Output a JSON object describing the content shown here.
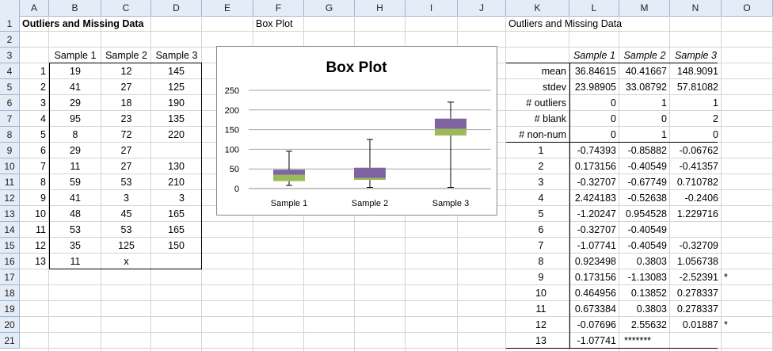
{
  "columns": [
    "A",
    "B",
    "C",
    "D",
    "E",
    "F",
    "G",
    "H",
    "I",
    "J",
    "K",
    "L",
    "M",
    "N",
    "O"
  ],
  "rows": [
    "1",
    "2",
    "3",
    "4",
    "5",
    "6",
    "7",
    "8",
    "9",
    "10",
    "11",
    "12",
    "13",
    "14",
    "15",
    "16",
    "17",
    "18",
    "19",
    "20",
    "21"
  ],
  "left_title": "Outliers and Missing Data",
  "chart_label": "Box Plot",
  "right_title": "Outliers and Missing Data",
  "left_table": {
    "headers": [
      "Sample 1",
      "Sample 2",
      "Sample 3"
    ],
    "rows": [
      [
        "1",
        "19",
        "12",
        "145"
      ],
      [
        "2",
        "41",
        "27",
        "125"
      ],
      [
        "3",
        "29",
        "18",
        "190"
      ],
      [
        "4",
        "95",
        "23",
        "135"
      ],
      [
        "5",
        "8",
        "72",
        "220"
      ],
      [
        "6",
        "29",
        "27",
        ""
      ],
      [
        "7",
        "11",
        "27",
        "130"
      ],
      [
        "8",
        "59",
        "53",
        "210"
      ],
      [
        "9",
        "41",
        "3",
        "3"
      ],
      [
        "10",
        "48",
        "45",
        "165"
      ],
      [
        "11",
        "53",
        "53",
        "165"
      ],
      [
        "12",
        "35",
        "125",
        "150"
      ],
      [
        "13",
        "11",
        "x",
        ""
      ]
    ]
  },
  "right_table": {
    "headers": [
      "Sample 1",
      "Sample 2",
      "Sample 3"
    ],
    "stats": [
      [
        "mean",
        "36.84615",
        "40.41667",
        "148.9091"
      ],
      [
        "stdev",
        "23.98905",
        "33.08792",
        "57.81082"
      ],
      [
        "# outliers",
        "0",
        "1",
        "1"
      ],
      [
        "# blank",
        "0",
        "0",
        "2"
      ],
      [
        "# non-num",
        "0",
        "1",
        "0"
      ]
    ],
    "z_rows": [
      [
        "1",
        "-0.74393",
        "-0.85882",
        "-0.06762",
        ""
      ],
      [
        "2",
        "0.173156",
        "-0.40549",
        "-0.41357",
        ""
      ],
      [
        "3",
        "-0.32707",
        "-0.67749",
        "0.710782",
        ""
      ],
      [
        "4",
        "2.424183",
        "-0.52638",
        "-0.2406",
        ""
      ],
      [
        "5",
        "-1.20247",
        "0.954528",
        "1.229716",
        ""
      ],
      [
        "6",
        "-0.32707",
        "-0.40549",
        "",
        ""
      ],
      [
        "7",
        "-1.07741",
        "-0.40549",
        "-0.32709",
        ""
      ],
      [
        "8",
        "0.923498",
        "0.3803",
        "1.056738",
        ""
      ],
      [
        "9",
        "0.173156",
        "-1.13083",
        "-2.52391",
        "*"
      ],
      [
        "10",
        "0.464956",
        "0.13852",
        "0.278337",
        ""
      ],
      [
        "11",
        "0.673384",
        "0.3803",
        "0.278337",
        ""
      ],
      [
        "12",
        "-0.07696",
        "2.55632",
        "0.01887",
        "*"
      ],
      [
        "13",
        "-1.07741",
        "*******",
        "",
        ""
      ]
    ]
  },
  "chart_data": {
    "type": "box",
    "title": "Box Plot",
    "ylim": [
      0,
      250
    ],
    "yticks": [
      "0",
      "50",
      "100",
      "150",
      "200",
      "250"
    ],
    "categories": [
      "Sample 1",
      "Sample 2",
      "Sample 3"
    ],
    "boxes": [
      {
        "min": 8,
        "q1": 19,
        "median": 35,
        "q3": 48,
        "max": 95
      },
      {
        "min": 3,
        "q1": 22,
        "median": 27,
        "q3": 53,
        "max": 125
      },
      {
        "min": 3,
        "q1": 135,
        "median": 152,
        "q3": 178,
        "max": 220
      }
    ],
    "colors": {
      "lower_box": "#9bbb59",
      "upper_box": "#8064a2",
      "grid": "#a6a6a6"
    }
  }
}
